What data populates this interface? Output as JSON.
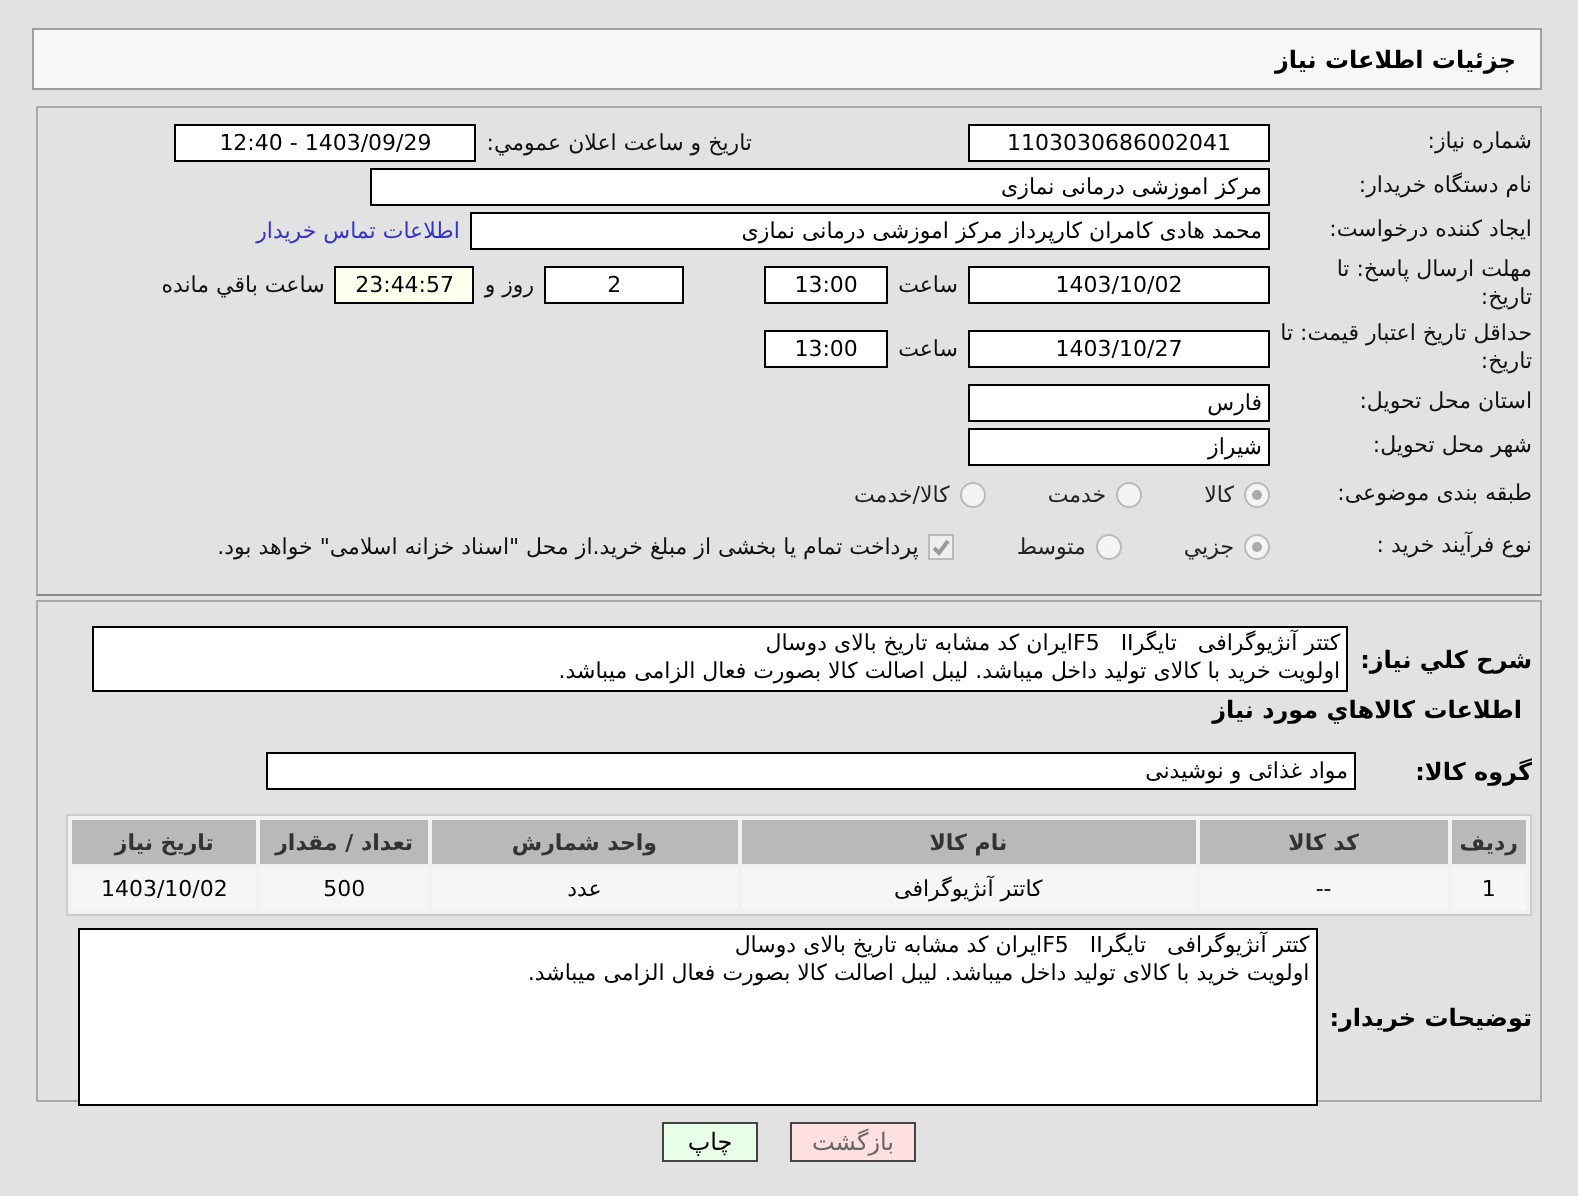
{
  "header": {
    "title": "جزئیات اطلاعات نیاز"
  },
  "details": {
    "need_number": {
      "label": "شماره نیاز:",
      "value": "1103030686002041"
    },
    "announce": {
      "label": "تاریخ و ساعت اعلان عمومي:",
      "value": "1403/09/29 - 12:40"
    },
    "buyer_org": {
      "label": "نام دستگاه خریدار:",
      "value": "مرکز اموزشی درمانی نمازی"
    },
    "creator": {
      "label": "ایجاد کننده درخواست:",
      "value": "محمد هادی کامران کارپرداز مرکز اموزشی درمانی نمازی",
      "link": "اطلاعات تماس خریدار"
    },
    "reply_deadline": {
      "label": "مهلت ارسال پاسخ: تا تاریخ:",
      "date": "1403/10/02",
      "time_label": "ساعت",
      "time": "13:00",
      "days": "2",
      "days_label": "روز و",
      "remaining": "23:44:57",
      "remaining_label": "ساعت باقي مانده"
    },
    "price_validity": {
      "label": "حداقل تاریخ اعتبار قیمت: تا تاریخ:",
      "date": "1403/10/27",
      "time_label": "ساعت",
      "time": "13:00"
    },
    "province": {
      "label": "استان محل تحویل:",
      "value": "فارس"
    },
    "city": {
      "label": "شهر محل تحویل:",
      "value": "شیراز"
    },
    "category": {
      "label": "طبقه بندی موضوعی:",
      "options": [
        {
          "label": "کالا",
          "selected": true
        },
        {
          "label": "خدمت",
          "selected": false
        },
        {
          "label": "کالا/خدمت",
          "selected": false
        }
      ]
    },
    "purchase_type": {
      "label": "نوع فرآیند خرید :",
      "options": [
        {
          "label": "جزیي",
          "selected": true
        },
        {
          "label": "متوسط",
          "selected": false
        }
      ],
      "payment": {
        "checked": true,
        "text": "پرداخت تمام یا بخشی از مبلغ خرید.از محل \"اسناد خزانه اسلامی\" خواهد بود."
      }
    }
  },
  "summary": {
    "label": "شرح کلي نياز:",
    "lines": [
      "کتتر آنژیوگرافی   تایگرF5   IIایران کد مشابه تاریخ بالای دوسال",
      "اولویت خرید با کالای تولید داخل میباشد. لیبل اصالت کالا بصورت فعال الزامی میباشد."
    ]
  },
  "goods": {
    "title": "اطلاعات کالاهاي مورد نياز",
    "group": {
      "label": "گروه کالا:",
      "value": "مواد غذائی و نوشیدنی"
    },
    "table": {
      "columns": [
        "ردیف",
        "کد کالا",
        "نام کالا",
        "واحد شمارش",
        "تعداد / مقدار",
        "تاریخ نیاز"
      ],
      "rows": [
        [
          "1",
          "--",
          "کاتتر آنژیوگرافی",
          "عدد",
          "500",
          "1403/10/02"
        ]
      ]
    },
    "buyer_notes": {
      "label": "توضیحات خریدار:",
      "lines": [
        "کتتر آنژیوگرافی   تایگرF5   IIایران کد مشابه تاریخ بالای دوسال",
        "اولویت خرید با کالای تولید داخل میباشد. لیبل اصالت کالا بصورت فعال الزامی میباشد."
      ]
    }
  },
  "buttons": [
    {
      "label": "بازگشت",
      "kind": "back"
    },
    {
      "label": "چاپ",
      "kind": "print"
    }
  ]
}
